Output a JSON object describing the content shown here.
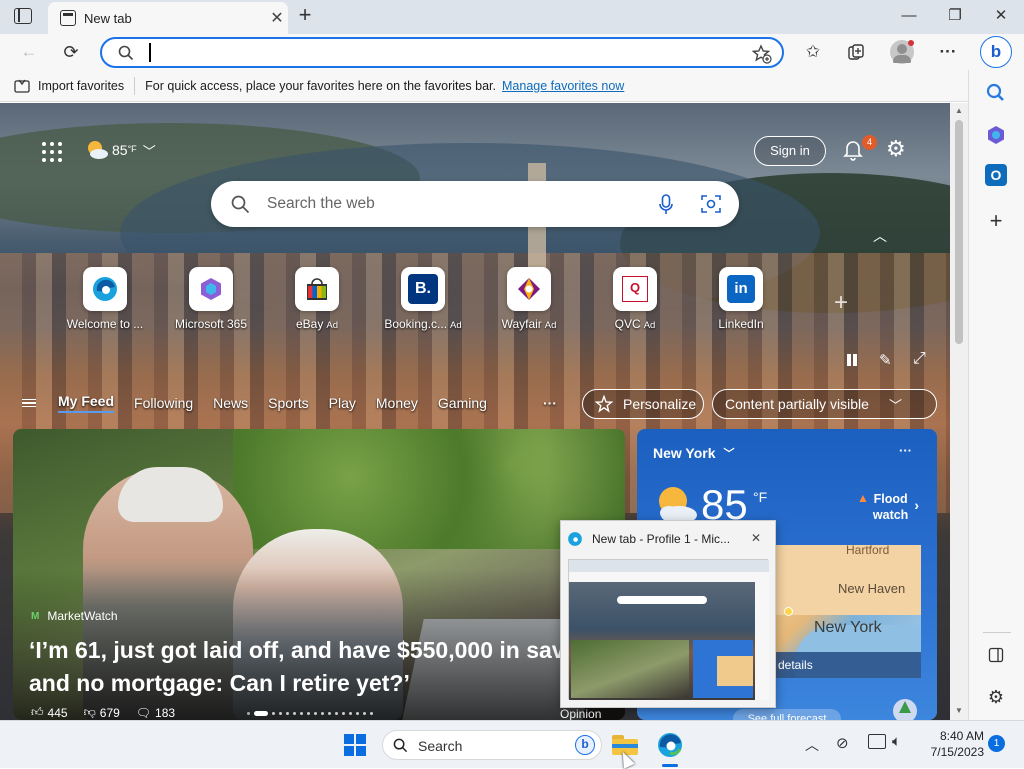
{
  "tab": {
    "title": "New tab",
    "close": "✕"
  },
  "window": {
    "minimize": "—",
    "restore": "❐",
    "close": "✕"
  },
  "address": {
    "value": "",
    "placeholder": ""
  },
  "favorites_bar": {
    "import_label": "Import favorites",
    "hint": "For quick access, place your favorites here on the favorites bar.",
    "manage_link": "Manage favorites now"
  },
  "page": {
    "weather_temp": "85",
    "weather_unit": "°F",
    "sign_in": "Sign in",
    "notification_count": "4",
    "search_placeholder": "Search the web",
    "quick_links": [
      {
        "label": "Welcome to ...",
        "ad": ""
      },
      {
        "label": "Microsoft 365",
        "ad": ""
      },
      {
        "label": "eBay",
        "ad": "Ad"
      },
      {
        "label": "Booking.c...",
        "ad": "Ad"
      },
      {
        "label": "Wayfair",
        "ad": "Ad"
      },
      {
        "label": "QVC",
        "ad": "Ad"
      },
      {
        "label": "LinkedIn",
        "ad": ""
      }
    ],
    "feed_tabs": [
      "My Feed",
      "Following",
      "News",
      "Sports",
      "Play",
      "Money",
      "Gaming"
    ],
    "personalize": "Personalize",
    "content_visibility": "Content partially visible"
  },
  "hero": {
    "source": "MarketWatch",
    "headline_line1": "‘I’m 61, just got laid off, and have $550,000 in sav",
    "headline_line2": "and no mortgage: Can I retire yet?’",
    "likes": "445",
    "dislikes": "679",
    "comments": "183",
    "tag": "Opinion"
  },
  "weather_card": {
    "city": "New York",
    "temp": "85",
    "unit": "°F",
    "alert_line1": "Flood",
    "alert_line2": "watch",
    "map_labels": [
      "Hartford",
      "New Haven",
      "New York"
    ],
    "details": "details",
    "forecast": "See full forecast"
  },
  "thumbnail": {
    "title": "New tab - Profile 1 - Mic...",
    "close": "✕"
  },
  "taskbar": {
    "search": "Search",
    "time": "8:40 AM",
    "date": "7/15/2023",
    "badge": "1"
  },
  "colors": {
    "accent": "#1a73e8",
    "weather_blue": "#2b6fd0",
    "notif": "#e25c2a"
  }
}
